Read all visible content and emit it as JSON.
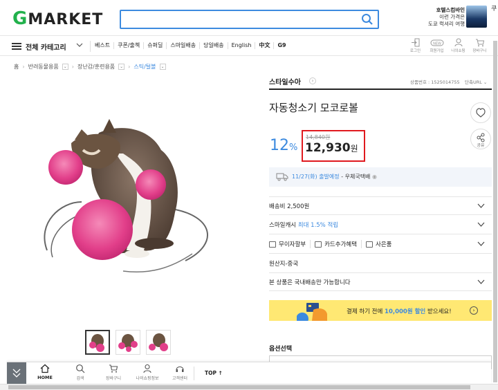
{
  "header": {
    "logo_g": "G",
    "logo_rest": "MARKET",
    "search_placeholder": "",
    "promo_line1": "호텔스컴바인",
    "promo_line2": "이런 가격은",
    "promo_line3": "도쿄 럭셔리 여행",
    "edge_char": "쿠"
  },
  "nav": {
    "all_categories": "전체 카테고리",
    "links": [
      "베스트",
      "쿠폰/출첵",
      "슈퍼딜",
      "스마일배송",
      "당일배송",
      "English",
      "中文",
      "G9"
    ],
    "icons": [
      {
        "icon": "login-icon",
        "label": "로그인"
      },
      {
        "icon": "new-badge-icon",
        "label": "회원가입",
        "badge": "NEW"
      },
      {
        "icon": "person-icon",
        "label": "나의쇼핑"
      },
      {
        "icon": "cart-icon",
        "label": "장바구니"
      }
    ]
  },
  "breadcrumb": [
    "홈",
    "반려동물용품",
    "장난감/훈련용품",
    "스틱/털볼"
  ],
  "product": {
    "shop_name": "스타일수아",
    "product_no_label": "상품번호 : 1525014755",
    "short_url": "단축URL",
    "title": "자동청소기 모코로볼",
    "discount_num": "12",
    "discount_unit": "%",
    "old_price": "14,840원",
    "new_price": "12,930",
    "price_unit": "원",
    "share_label": "공유"
  },
  "shipping": {
    "date": "11/27(화) 출발예정",
    "method": "- 우체국택배"
  },
  "rows": {
    "ship_fee": "배송비 2,500원",
    "smile_cash_prefix": "스마일캐시 ",
    "smile_cash_highlight": "최대 1.5% 적립",
    "tags": [
      "무이자할부",
      "카드추가혜택",
      "사은품"
    ],
    "origin": "원산지-중국",
    "domestic": "본 상품은 국내배송만 가능합니다"
  },
  "banner": {
    "prefix": "결제 하기 전에 ",
    "highlight": "10,000원 할인",
    "suffix": " 받으세요!"
  },
  "options": {
    "label": "옵션선택"
  },
  "bottom_bar": {
    "items": [
      {
        "icon": "home-icon",
        "label": "HOME"
      },
      {
        "icon": "search-icon",
        "label": "검색"
      },
      {
        "icon": "cart-icon",
        "label": "장바구니"
      },
      {
        "icon": "person-icon",
        "label": "나의쇼핑정보"
      },
      {
        "icon": "headset-icon",
        "label": "고객센터"
      }
    ],
    "top_label": "TOP ↑"
  },
  "colors": {
    "accent_blue": "#3c8adf",
    "brand_green": "#22b14c",
    "highlight_red": "#e0191e",
    "banner_yellow": "#ffe873"
  }
}
